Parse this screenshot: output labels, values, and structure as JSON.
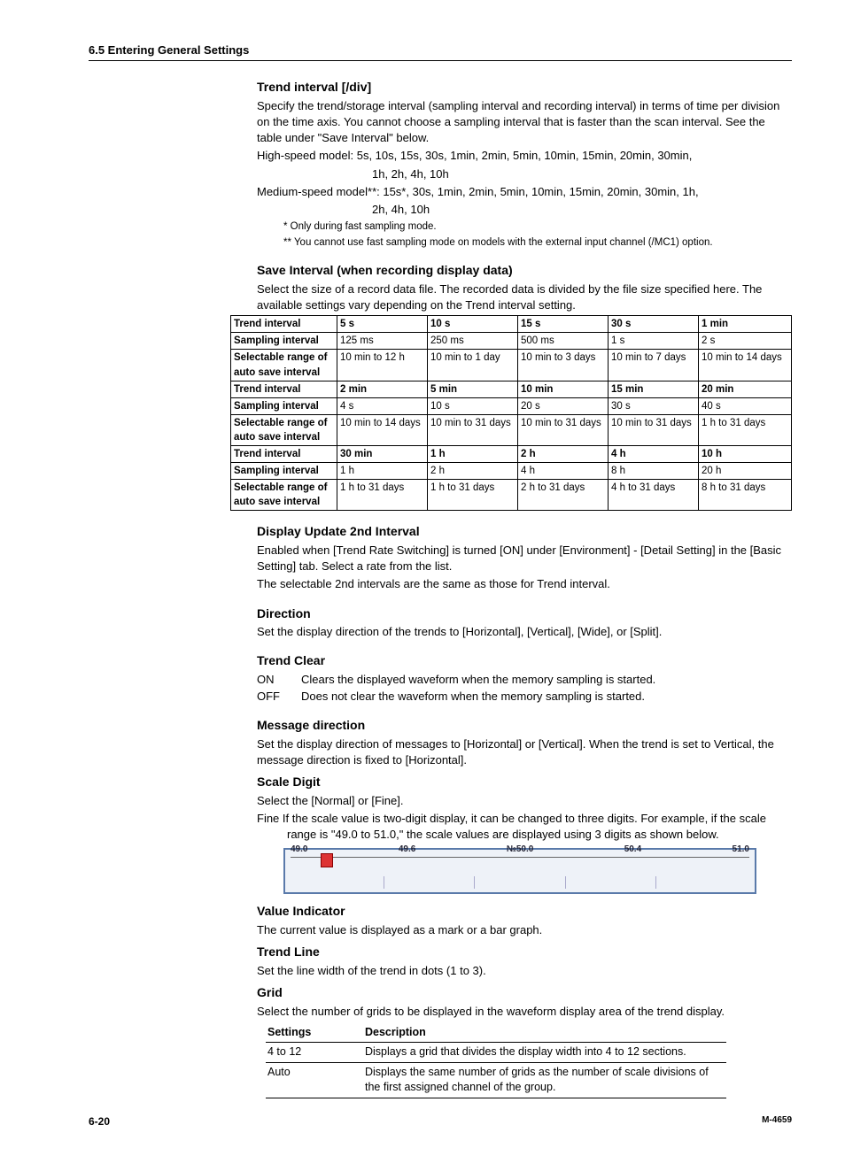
{
  "header": "6.5  Entering General Settings",
  "s1": {
    "title": "Trend interval [/div]",
    "p1": "Specify the trend/storage interval (sampling interval and recording interval) in terms of time per division on the time axis. You cannot choose a sampling interval that is faster than the scan interval. See the table under \"Save Interval\" below.",
    "p2a": "High-speed model: 5s, 10s, 15s, 30s, 1min, 2min, 5min, 10min, 15min, 20min, 30min,",
    "p2b": "1h, 2h, 4h, 10h",
    "p3a": "Medium-speed model**: 15s*, 30s, 1min, 2min, 5min, 10min, 15min, 20min, 30min, 1h,",
    "p3b": "2h, 4h, 10h",
    "fn1": "*   Only during fast sampling mode.",
    "fn2": "**  You cannot use fast sampling mode on models with the external input channel (/MC1) option."
  },
  "s2": {
    "title": "Save Interval (when recording display data)",
    "p1": "Select the size of a record data file.  The recorded data is divided by the file size specified here.  The available settings vary depending on the Trend interval setting.",
    "rows": [
      [
        "Trend interval",
        "5 s",
        "10 s",
        "15 s",
        "30 s",
        "1 min"
      ],
      [
        "Sampling interval",
        "125 ms",
        "250 ms",
        "500 ms",
        "1 s",
        "2 s"
      ],
      [
        "Selectable range of auto save interval",
        "10 min to 12 h",
        "10 min to 1 day",
        "10 min to 3 days",
        "10 min to 7 days",
        "10 min to 14 days"
      ],
      [
        "Trend interval",
        "2 min",
        "5 min",
        "10 min",
        "15 min",
        "20 min"
      ],
      [
        "Sampling interval",
        "4 s",
        "10 s",
        "20 s",
        "30 s",
        "40 s"
      ],
      [
        "Selectable range of auto save interval",
        "10 min to 14 days",
        "10 min to 31 days",
        "10 min to 31 days",
        "10 min to 31 days",
        "1 h to 31 days"
      ],
      [
        "Trend interval",
        "30 min",
        "1 h",
        "2 h",
        "4 h",
        "10 h"
      ],
      [
        "Sampling interval",
        "1 h",
        "2 h",
        "4 h",
        "8 h",
        "20 h"
      ],
      [
        "Selectable range of auto save interval",
        "1 h to 31 days",
        "1 h to 31 days",
        "2 h to 31 days",
        "4 h to 31 days",
        "8 h to 31 days"
      ]
    ]
  },
  "s3": {
    "title": "Display Update 2nd Interval",
    "p1": "Enabled when [Trend Rate Switching] is turned [ON] under [Environment] - [Detail Setting] in the [Basic Setting] tab. Select a rate from the list.",
    "p2": "The selectable 2nd intervals are the same as those for Trend interval."
  },
  "s4": {
    "title": "Direction",
    "p1": "Set the display direction of the trends to [Horizontal], [Vertical], [Wide], or [Split]."
  },
  "s5": {
    "title": "Trend Clear",
    "on_k": "ON",
    "on_v": "Clears the displayed waveform when the memory sampling is started.",
    "off_k": "OFF",
    "off_v": "Does not clear the waveform when the memory sampling is started."
  },
  "s6": {
    "title": "Message direction",
    "p1": "Set the display direction of messages to [Horizontal] or [Vertical].  When the trend is set to Vertical, the message direction is fixed to [Horizontal]."
  },
  "s7": {
    "title": "Scale Digit",
    "p1": "Select the [Normal] or [Fine].",
    "p2": "Fine  If the scale value is two-digit display, it can be changed to three digits.  For example, if the scale range is \"49.0 to 51.0,\" the scale values are displayed using 3 digits as shown below.",
    "ticks": [
      "49.0",
      "49.6",
      "№50.0",
      "50.4",
      "51.0"
    ]
  },
  "s8": {
    "title": "Value Indicator",
    "p1": "The current value is displayed as a mark or a bar graph."
  },
  "s9": {
    "title": "Trend Line",
    "p1": "Set the line width of the trend in dots (1 to 3)."
  },
  "s10": {
    "title": "Grid",
    "p1": "Select the number of grids to be displayed in the waveform display area of the trend display.",
    "th1": "Settings",
    "th2": "Description",
    "r1a": "4 to 12",
    "r1b": "Displays a grid that divides the display width into 4 to 12 sections.",
    "r2a": "Auto",
    "r2b": "Displays the same number of grids as the number of scale divisions of the first assigned channel of the group."
  },
  "footer": {
    "page": "6-20",
    "doc": "M-4659"
  }
}
